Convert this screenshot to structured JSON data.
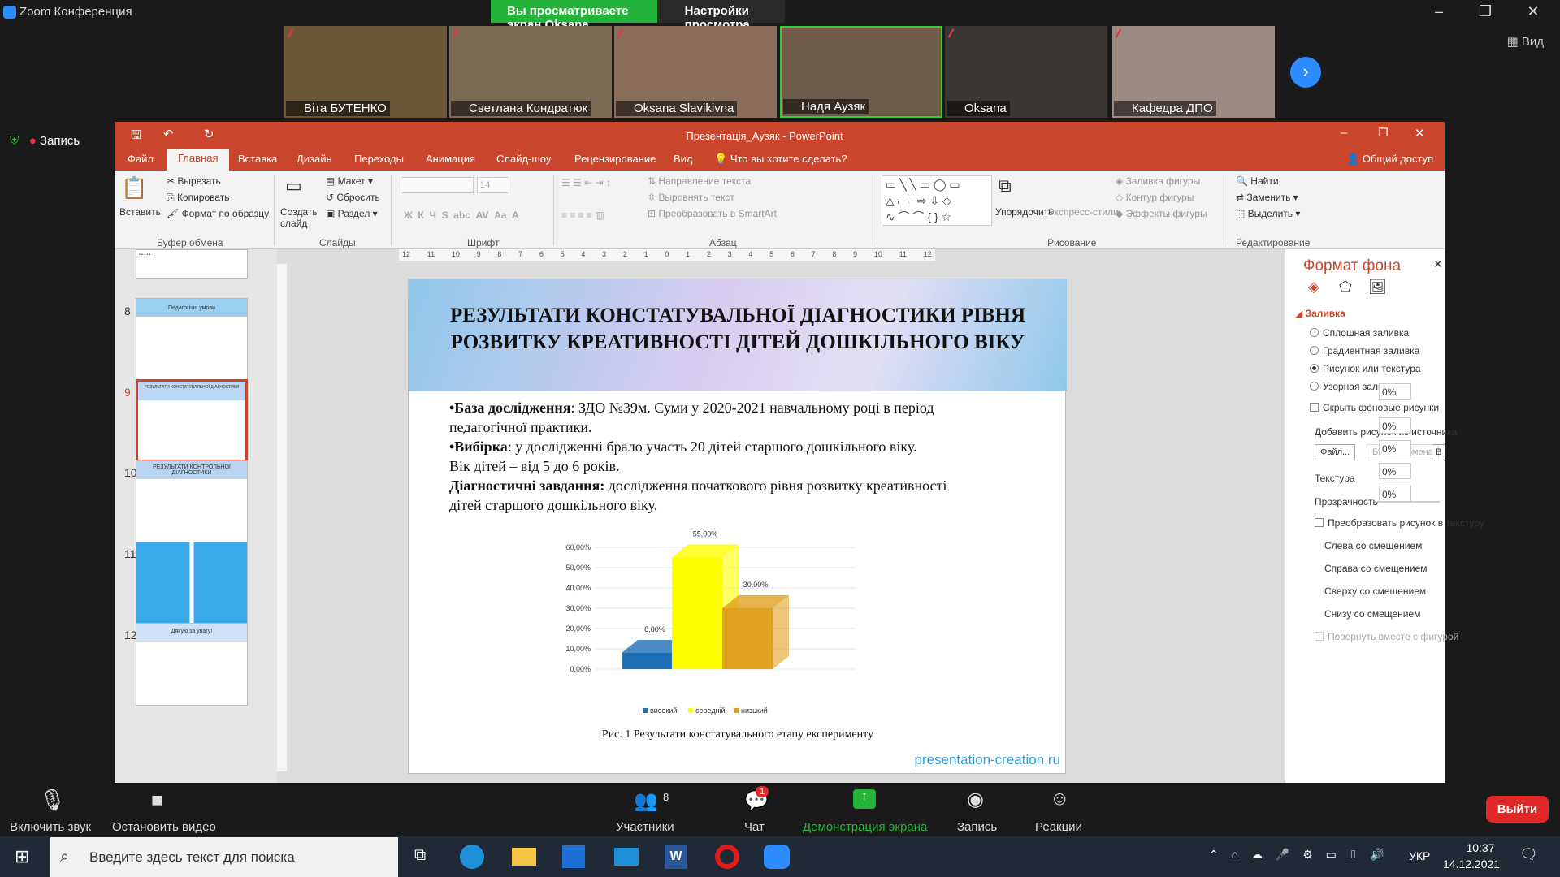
{
  "zoom": {
    "title": "Zoom Конференция",
    "viewing_banner": "Вы просматриваете экран Oksana Slavikivna",
    "view_settings": "Настройки просмотра",
    "view_label": "Вид",
    "record_indicator": "Запись",
    "participants": [
      "Віта БУТЕНКО",
      "Светлана Кондратюк",
      "Oksana Slavikivna",
      "Надя Аузяк",
      "Oksana",
      "Кафедра ДПО"
    ],
    "bottom": {
      "audio": "Включить звук",
      "video": "Остановить видео",
      "participants_label": "Участники",
      "participants_count": "8",
      "chat": "Чат",
      "chat_badge": "1",
      "share": "Демонстрация экрана",
      "record": "Запись",
      "reactions": "Реакции",
      "leave": "Выйти"
    }
  },
  "ppt": {
    "title": "Презентація_Аузяк - PowerPoint",
    "tabs": [
      "Файл",
      "Главная",
      "Вставка",
      "Дизайн",
      "Переходы",
      "Анимация",
      "Слайд-шоу",
      "Рецензирование",
      "Вид"
    ],
    "tell_me": "Что вы хотите сделать?",
    "share": "Общий доступ",
    "ribbon": {
      "paste": "Вставить",
      "cut": "Вырезать",
      "copy": "Копировать",
      "format_painter": "Формат по образцу",
      "clipboard": "Буфер обмена",
      "new_slide": "Создать слайд",
      "layout": "Макет",
      "reset": "Сбросить",
      "section": "Раздел",
      "slides": "Слайды",
      "font": "Шрифт",
      "font_size": "14",
      "paragraph": "Абзац",
      "text_direction": "Направление текста",
      "align_text": "Выровнять текст",
      "smartart": "Преобразовать в SmartArt",
      "arrange": "Упорядочить",
      "quick_styles": "Экспресс-стили",
      "shape_fill": "Заливка фигуры",
      "shape_outline": "Контур фигуры",
      "shape_effects": "Эффекты фигуры",
      "drawing": "Рисование",
      "find": "Найти",
      "replace": "Заменить",
      "select": "Выделить",
      "editing": "Редактирование"
    },
    "slide_numbers": [
      "8",
      "9",
      "10",
      "11",
      "12"
    ],
    "thumb_titles": [
      "Педагогічні умови",
      "РЕЗУЛЬТАТИ КОНСТАТУВАЛЬНОЇ ДІАГНОСТИКИ",
      "РЕЗУЛЬТАТИ КОНТРОЛЬНОЇ ДІАГНОСТИКИ",
      "",
      "Дякую за увагу!"
    ],
    "ruler": [
      "12",
      "11",
      "10",
      "9",
      "8",
      "7",
      "6",
      "5",
      "4",
      "3",
      "2",
      "1",
      "0",
      "1",
      "2",
      "3",
      "4",
      "5",
      "6",
      "7",
      "8",
      "9",
      "10",
      "11",
      "12"
    ],
    "slide": {
      "title": "РЕЗУЛЬТАТИ КОНСТАТУВАЛЬНОЇ ДІАГНОСТИКИ РІВНЯ РОЗВИТКУ КРЕАТИВНОСТІ ДІТЕЙ ДОШКІЛЬНОГО ВІКУ",
      "l1b": "•База дослідження",
      "l1": ": ЗДО №39м. Суми у 2020-2021 навчальному році в період",
      "l2": "педагогічної практики.",
      "l3b": "•Вибірка",
      "l3": ": у дослідженні брало участь 20 дітей старшого дошкільного віку.",
      "l4": "Вік дітей – від 5 до 6 років.",
      "l5b": "Діагностичні завдання:",
      "l5": " дослідження початкового рівня розвитку креативності",
      "l6": "дітей старшого дошкільного віку.",
      "caption": "Рис. 1 Результати констатувального етапу експерименту",
      "site": "presentation-creation.ru"
    },
    "format_pane": {
      "title": "Формат фона",
      "fill": "Заливка",
      "solid": "Сплошная заливка",
      "gradient": "Градиентная заливка",
      "picture": "Рисунок или текстура",
      "pattern": "Узорная заливка",
      "hide_bg": "Скрыть фоновые рисунки",
      "insert_from": "Добавить рисунок из источника",
      "file_btn": "Файл...",
      "clipboard_btn": "Буфер обмена",
      "online_btn": "В Интернет",
      "texture": "Текстура",
      "transparency": "Прозрачность",
      "transparency_val": "0%",
      "tile": "Преобразовать рисунок в текстуру",
      "left_off": "Слева со смещением",
      "right_off": "Справа со смещением",
      "top_off": "Сверху со смещением",
      "bottom_off": "Снизу со смещением",
      "offset_val": "0%",
      "rotate": "Повернуть вместе с фигурой"
    }
  },
  "taskbar": {
    "search": "Введите здесь текст для поиска",
    "lang": "УКР",
    "time": "10:37",
    "date": "14.12.2021"
  },
  "chart_data": {
    "type": "bar",
    "categories": [
      ""
    ],
    "series": [
      {
        "name": "високий",
        "values": [
          8
        ]
      },
      {
        "name": "середній",
        "values": [
          55
        ]
      },
      {
        "name": "низький",
        "values": [
          30
        ]
      }
    ],
    "data_labels": [
      "8,00%",
      "55,00%",
      "30,00%"
    ],
    "ytick_labels": [
      "0,00%",
      "10,00%",
      "20,00%",
      "30,00%",
      "40,00%",
      "50,00%",
      "60,00%"
    ],
    "ylim": [
      0,
      60
    ],
    "colors": [
      "#1f6fb5",
      "#ffff00",
      "#e0a020"
    ],
    "legend": "bottom"
  }
}
